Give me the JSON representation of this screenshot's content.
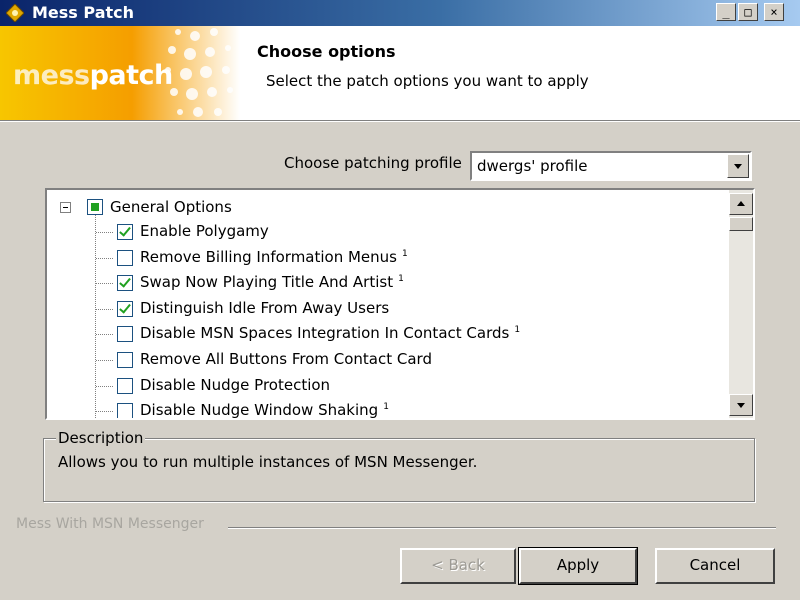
{
  "window": {
    "title": "Mess Patch",
    "controls": {
      "minimize": "_",
      "maximize": "□",
      "close": "×"
    }
  },
  "header": {
    "logo_part1": "mess",
    "logo_part2": "patch",
    "title": "Choose options",
    "subtitle": "Select the patch options you want to apply"
  },
  "profile": {
    "label": "Choose patching profile",
    "selected": "dwergs' profile"
  },
  "tree": {
    "root": {
      "label": "General Options",
      "state": "partial"
    },
    "items": [
      {
        "label": "Enable Polygamy",
        "checked": true,
        "note": ""
      },
      {
        "label": "Remove Billing Information Menus",
        "checked": false,
        "note": "1"
      },
      {
        "label": "Swap Now Playing Title And Artist",
        "checked": true,
        "note": "1"
      },
      {
        "label": "Distinguish Idle From Away Users",
        "checked": true,
        "note": ""
      },
      {
        "label": "Disable MSN Spaces Integration In Contact Cards",
        "checked": false,
        "note": "1"
      },
      {
        "label": "Remove All Buttons From Contact Card",
        "checked": false,
        "note": ""
      },
      {
        "label": "Disable Nudge Protection",
        "checked": false,
        "note": ""
      },
      {
        "label": "Disable Nudge Window Shaking",
        "checked": false,
        "note": "1"
      }
    ]
  },
  "description": {
    "legend": "Description",
    "text": "Allows you to run multiple instances of MSN Messenger."
  },
  "footer": {
    "brand": "Mess With MSN Messenger",
    "back_label": "< Back",
    "apply_label": "Apply",
    "cancel_label": "Cancel"
  },
  "colors": {
    "titlebar": "#0a246a",
    "logo_orange": "#f59e00",
    "check_green": "#21a121",
    "face": "#d4d0c8"
  }
}
